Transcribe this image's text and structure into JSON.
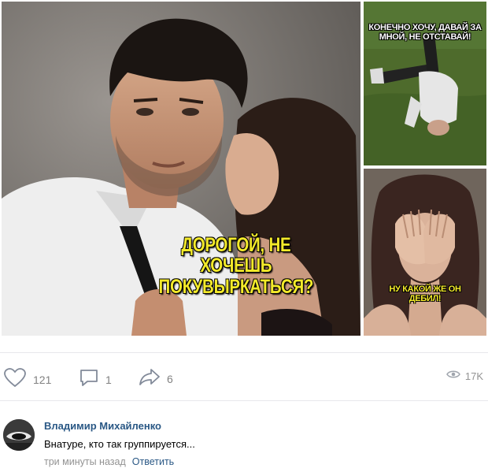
{
  "post": {
    "images": [
      {
        "caption": "ДОРОГОЙ, НЕ ХОЧЕШЬ ПОКУВЫРКАТЬСЯ?"
      },
      {
        "caption": "КОНЕЧНО ХОЧУ, ДАВАЙ ЗА МНОЙ, НЕ ОТСТАВАЙ!"
      },
      {
        "caption": "НУ КАКОЙ ЖЕ ОН ДЕБИЛ!"
      }
    ],
    "likes": "121",
    "comments": "1",
    "shares": "6",
    "views": "17K"
  },
  "comment": {
    "author": "Владимир Михайленко",
    "text": "Внатуре, кто так группируется...",
    "time": "три минуты назад",
    "reply_label": "Ответить"
  },
  "colors": {
    "link": "#2a5885",
    "muted": "#939393",
    "caption_yellow": "#f3ea2a"
  }
}
